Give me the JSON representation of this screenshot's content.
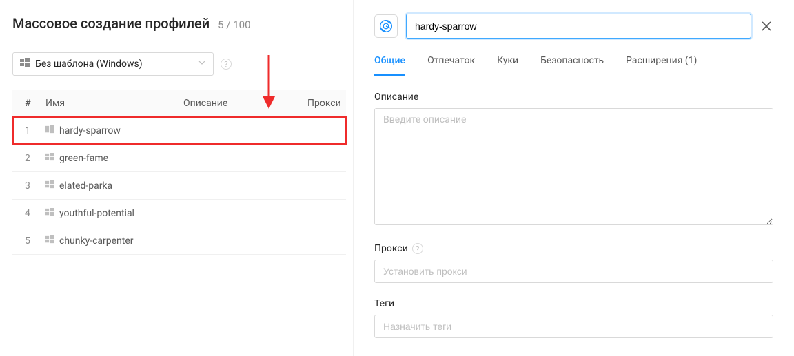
{
  "header": {
    "title": "Массовое создание профилей",
    "count": "5 / 100"
  },
  "template": {
    "selected": "Без шаблона (Windows)"
  },
  "table": {
    "columns": {
      "idx": "#",
      "name": "Имя",
      "desc": "Описание",
      "proxy": "Прокси"
    },
    "rows": [
      {
        "idx": "1",
        "name": "hardy-sparrow",
        "highlighted": true
      },
      {
        "idx": "2",
        "name": "green-fame"
      },
      {
        "idx": "3",
        "name": "elated-parka"
      },
      {
        "idx": "4",
        "name": "youthful-potential"
      },
      {
        "idx": "5",
        "name": "chunky-carpenter"
      }
    ]
  },
  "editor": {
    "name_value": "hardy-sparrow",
    "tabs": [
      {
        "label": "Общие",
        "active": true
      },
      {
        "label": "Отпечаток"
      },
      {
        "label": "Куки"
      },
      {
        "label": "Безопасность"
      },
      {
        "label": "Расширения (1)"
      }
    ],
    "desc_label": "Описание",
    "desc_placeholder": "Введите описание",
    "proxy_label": "Прокси",
    "proxy_placeholder": "Установить прокси",
    "tags_label": "Теги",
    "tags_placeholder": "Назначить теги"
  }
}
